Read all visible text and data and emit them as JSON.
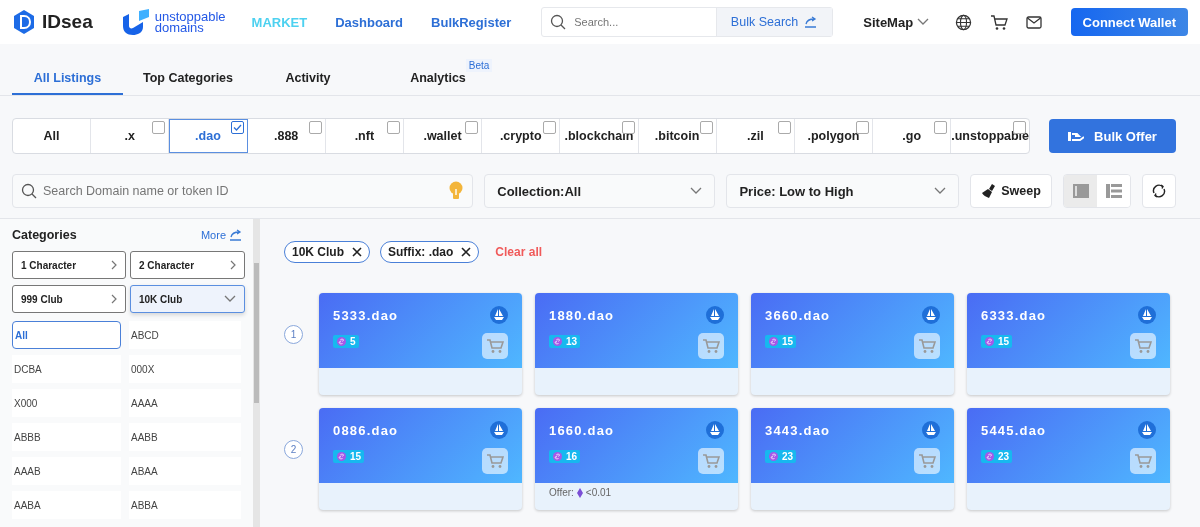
{
  "header": {
    "logo": "IDsea",
    "partner": [
      "unstoppable",
      "domains"
    ],
    "nav": [
      {
        "label": "MARKET",
        "selected": true
      },
      {
        "label": "Dashboard",
        "selected": false
      },
      {
        "label": "BulkRegister",
        "selected": false
      }
    ],
    "search": {
      "placeholder": "Search..."
    },
    "bulk_search": "Bulk Search",
    "sitemap": "SiteMap",
    "connect": "Connect Wallet"
  },
  "tabs": [
    {
      "label": "All Listings",
      "selected": true
    },
    {
      "label": "Top Categories",
      "selected": false
    },
    {
      "label": "Activity",
      "selected": false
    },
    {
      "label": "Analytics",
      "selected": false,
      "badge": "Beta"
    }
  ],
  "suffixes": [
    {
      "label": "All",
      "kind": "all",
      "selected": false
    },
    {
      "label": ".x",
      "kind": "suffix",
      "checked": false,
      "selected": false
    },
    {
      "label": ".dao",
      "kind": "suffix",
      "checked": true,
      "selected": true
    },
    {
      "label": ".888",
      "kind": "suffix",
      "checked": false,
      "selected": false
    },
    {
      "label": ".nft",
      "kind": "suffix",
      "checked": false,
      "selected": false
    },
    {
      "label": ".wallet",
      "kind": "suffix",
      "checked": false,
      "selected": false
    },
    {
      "label": ".crypto",
      "kind": "suffix",
      "checked": false,
      "selected": false
    },
    {
      "label": ".blockchain",
      "kind": "suffix",
      "checked": false,
      "selected": false
    },
    {
      "label": ".bitcoin",
      "kind": "suffix",
      "checked": false,
      "selected": false
    },
    {
      "label": ".zil",
      "kind": "suffix",
      "checked": false,
      "selected": false
    },
    {
      "label": ".polygon",
      "kind": "suffix",
      "checked": false,
      "selected": false
    },
    {
      "label": ".go",
      "kind": "suffix",
      "checked": false,
      "selected": false
    },
    {
      "label": ".unstoppable",
      "kind": "suffix",
      "checked": false,
      "selected": false
    }
  ],
  "bulk_offer": "Bulk Offer",
  "filters": {
    "search": {
      "placeholder": "Search Domain name or token ID"
    },
    "collection": "Collection:All",
    "sort": "Price: Low to High",
    "sweep": "Sweep",
    "views": [
      {
        "kind": "grid",
        "selected": true
      },
      {
        "kind": "list",
        "selected": false
      }
    ]
  },
  "categories": {
    "title": "Categories",
    "more": "More",
    "groups": [
      {
        "label": "1 Character",
        "expanded": false
      },
      {
        "label": "2 Character",
        "expanded": false
      },
      {
        "label": "999 Club",
        "expanded": false
      },
      {
        "label": "10K Club",
        "expanded": true
      }
    ],
    "items": [
      {
        "label": "All",
        "selected": true
      },
      {
        "label": "ABCD",
        "selected": false
      },
      {
        "label": "DCBA",
        "selected": false
      },
      {
        "label": "000X",
        "selected": false
      },
      {
        "label": "X000",
        "selected": false
      },
      {
        "label": "AAAA",
        "selected": false
      },
      {
        "label": "ABBB",
        "selected": false
      },
      {
        "label": "AABB",
        "selected": false
      },
      {
        "label": "AAAB",
        "selected": false
      },
      {
        "label": "ABAA",
        "selected": false
      },
      {
        "label": "AABA",
        "selected": false
      },
      {
        "label": "ABBA",
        "selected": false
      }
    ]
  },
  "chips": [
    {
      "label": "10K Club"
    },
    {
      "label": "Suffix: .dao"
    }
  ],
  "clear_all": "Clear all",
  "rows": [
    {
      "index": "1",
      "cards": [
        {
          "name": "5333.dao",
          "count": "5"
        },
        {
          "name": "1880.dao",
          "count": "13"
        },
        {
          "name": "3660.dao",
          "count": "15"
        },
        {
          "name": "6333.dao",
          "count": "15"
        }
      ]
    },
    {
      "index": "2",
      "cards": [
        {
          "name": "0886.dao",
          "count": "15"
        },
        {
          "name": "1660.dao",
          "count": "16",
          "offer": {
            "label": "Offer:",
            "value": "<0.01"
          }
        },
        {
          "name": "3443.dao",
          "count": "23"
        },
        {
          "name": "5445.dao",
          "count": "23"
        }
      ]
    }
  ]
}
